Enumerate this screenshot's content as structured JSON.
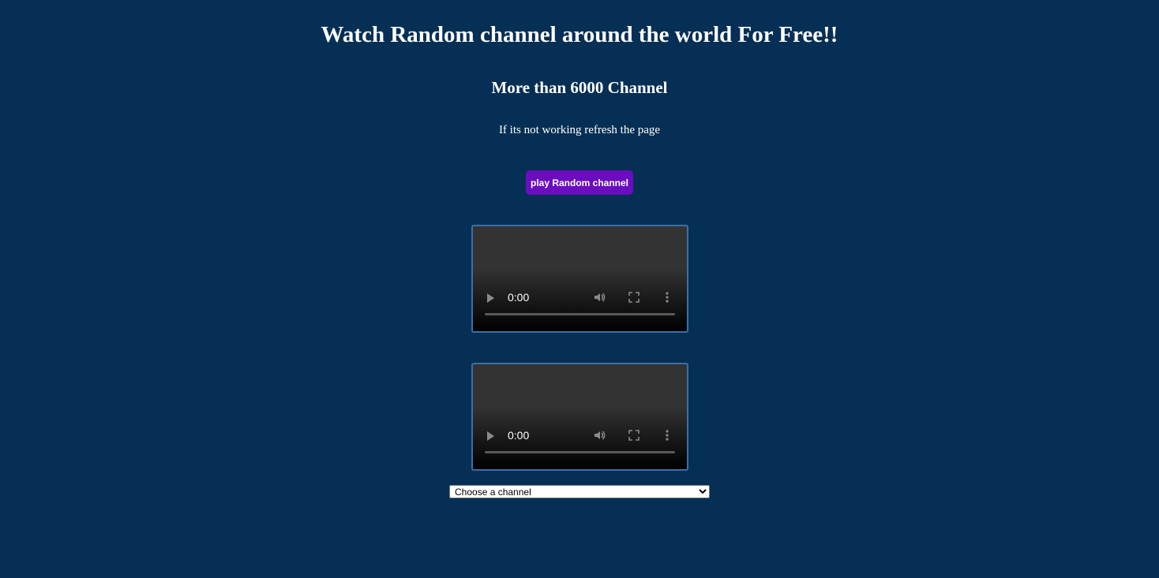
{
  "header": {
    "title": "Watch Random channel around the world For Free!!",
    "subtitle": "More than 6000 Channel",
    "note": "If its not working refresh the page"
  },
  "actions": {
    "play_random_label": "play Random channel"
  },
  "players": [
    {
      "time": "0:00",
      "icons": [
        "play-icon",
        "volume-icon",
        "fullscreen-icon",
        "more-options-icon"
      ]
    },
    {
      "time": "0:00",
      "icons": [
        "play-icon",
        "volume-icon",
        "fullscreen-icon",
        "more-options-icon"
      ]
    }
  ],
  "channel_select": {
    "selected": "Choose a channel"
  },
  "colors": {
    "background": "#062f55",
    "button": "#6a0dbf",
    "video_border": "#3d6fa5"
  }
}
